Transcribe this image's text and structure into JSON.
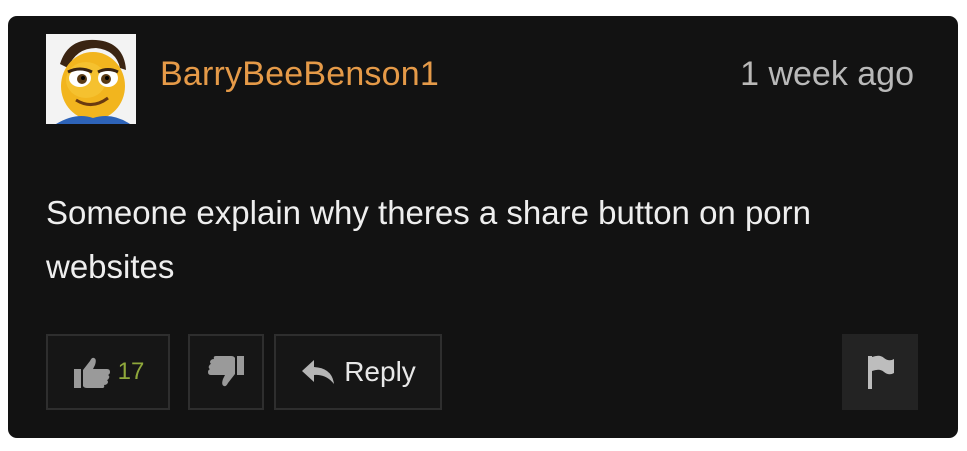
{
  "comment": {
    "username": "BarryBeeBenson1",
    "timestamp": "1 week ago",
    "text": "Someone explain why theres a share button on porn websites",
    "avatar": "cartoon-bee-face",
    "like_count": "17",
    "reply_label": "Reply"
  },
  "icons": {
    "like": "thumbs-up-icon",
    "dislike": "thumbs-down-icon",
    "reply": "reply-arrow-icon",
    "flag": "flag-icon"
  },
  "colors": {
    "card_background": "#121212",
    "username": "#e59a48",
    "timestamp": "#b9b9b9",
    "text": "#eeeeee",
    "like_count": "#8fa83b"
  }
}
